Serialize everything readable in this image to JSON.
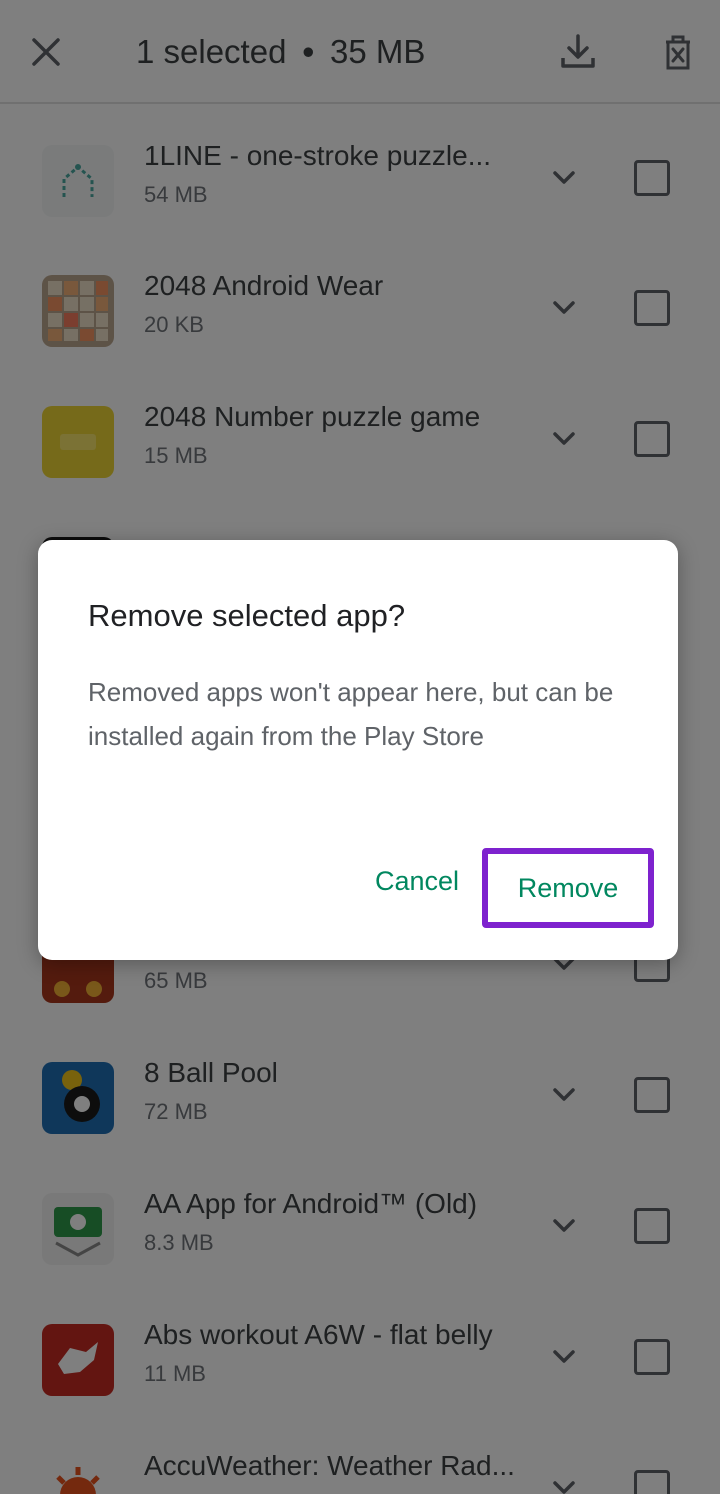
{
  "topbar": {
    "close_icon": "close-icon",
    "selected_count": "1 selected",
    "separator": "•",
    "selected_size": "35 MB",
    "download_icon": "download-icon",
    "delete_icon": "delete-icon"
  },
  "apps": [
    {
      "name": "1LINE - one-stroke puzzle...",
      "size": "54 MB",
      "icon": "1line-icon",
      "selected": false
    },
    {
      "name": "2048 Android Wear",
      "size": "20 KB",
      "icon": "2048-android-wear-icon",
      "selected": false
    },
    {
      "name": "2048 Number puzzle game",
      "size": "15 MB",
      "icon": "2048-number-puzzle-icon",
      "selected": false
    },
    {
      "name": "",
      "size": "65 MB",
      "icon": "game-icon",
      "selected": false
    },
    {
      "name": "8 Ball Pool",
      "size": "72 MB",
      "icon": "8-ball-pool-icon",
      "selected": false
    },
    {
      "name": "AA App for Android™ (Old)",
      "size": "8.3 MB",
      "icon": "aa-app-icon",
      "selected": false
    },
    {
      "name": "Abs workout A6W - flat belly",
      "size": "11 MB",
      "icon": "abs-workout-icon",
      "selected": false
    },
    {
      "name": "AccuWeather: Weather Rad...",
      "size": "",
      "icon": "accuweather-icon",
      "selected": false
    }
  ],
  "dialog": {
    "title": "Remove selected app?",
    "body": "Removed apps won't appear here, but can be installed again from the Play Store",
    "cancel_label": "Cancel",
    "remove_label": "Remove"
  },
  "colors": {
    "accent": "#01875f",
    "highlight": "#7e22ce",
    "scrim": "#000000"
  }
}
